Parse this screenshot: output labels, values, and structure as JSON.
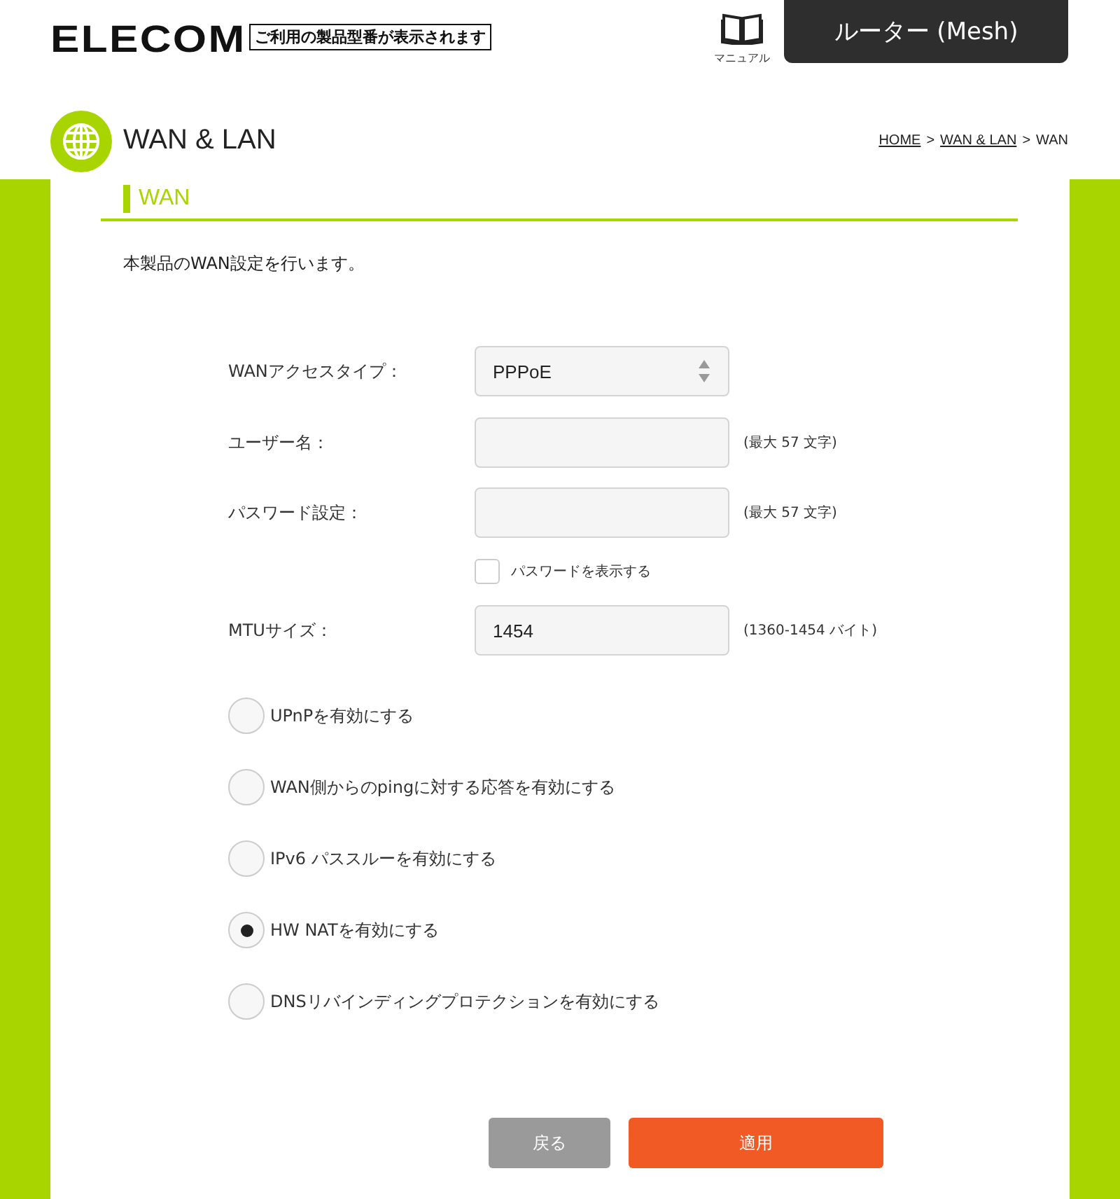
{
  "header": {
    "logo": "ELECOM",
    "model_notice": "ご利用の製品型番が表示されます",
    "manual": "マニュアル",
    "product_tab": "ルーター (Mesh)"
  },
  "page": {
    "title": "WAN & LAN",
    "breadcrumb": [
      {
        "label": "HOME",
        "link": true
      },
      {
        "label": "WAN & LAN",
        "link": true
      },
      {
        "label": "WAN",
        "link": false
      }
    ],
    "separator": ">"
  },
  "section": {
    "title": "WAN",
    "description": "本製品のWAN設定を行います。"
  },
  "fields": [
    {
      "kind": "select",
      "label": "WANアクセスタイプ：",
      "value": "PPPoE"
    },
    {
      "kind": "text",
      "label": "ユーザー名：",
      "note": "(最大 57 文字)"
    },
    {
      "kind": "text",
      "label": "パスワード設定：",
      "note": "(最大 57 文字)"
    },
    {
      "kind": "checkbox",
      "label": "パスワードを表示する",
      "checked": false
    },
    {
      "kind": "text",
      "label": "MTUサイズ：",
      "value": "1454",
      "note": "(1360-1454 バイト)"
    }
  ],
  "options": [
    {
      "label": "UPnPを有効にする",
      "checked": false
    },
    {
      "label": "WAN側からのpingに対する応答を有効にする",
      "checked": false
    },
    {
      "label": "IPv6 パススルーを有効にする",
      "checked": false
    },
    {
      "label": "HW NATを有効にする",
      "checked": true
    },
    {
      "label": "DNSリバインディングプロテクションを有効にする",
      "checked": false
    }
  ],
  "buttons": [
    {
      "kind": "back",
      "label": "戻る"
    },
    {
      "kind": "apply",
      "label": "適用"
    }
  ]
}
